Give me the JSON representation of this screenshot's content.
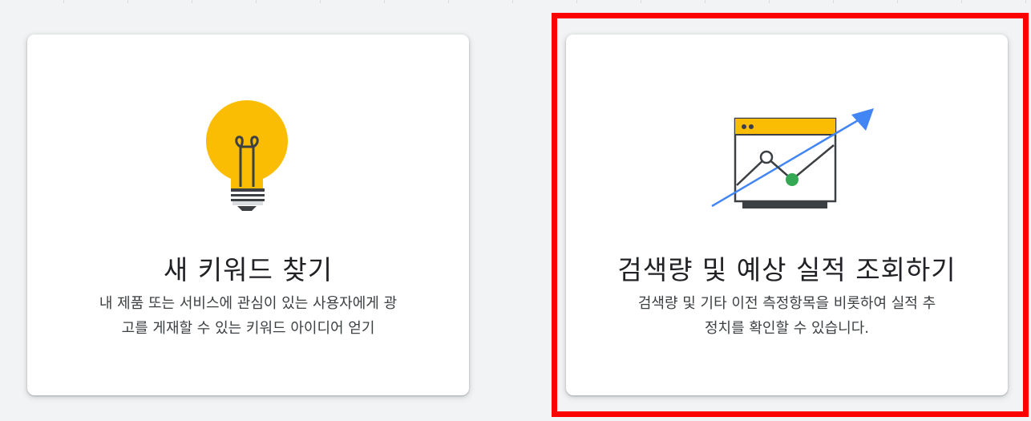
{
  "cards": [
    {
      "title": "새 키워드 찾기",
      "description_line1": "내 제품 또는 서비스에 관심이 있는 사용자에게 광",
      "description_line2": "고를 게재할 수 있는 키워드 아이디어 얻기",
      "icon": "lightbulb-icon"
    },
    {
      "title": "검색량 및 예상 실적 조회하기",
      "description_line1": "검색량 및 기타 이전 측정항목을 비롯하여 실적 추",
      "description_line2": "정치를 확인할 수 있습니다.",
      "icon": "trend-chart-icon"
    }
  ],
  "colors": {
    "background": "#f1f3f4",
    "card": "#ffffff",
    "bulb": "#fbbc04",
    "trend_arrow": "#4285f4",
    "point_green": "#34a853",
    "highlight": "#ff0000"
  }
}
